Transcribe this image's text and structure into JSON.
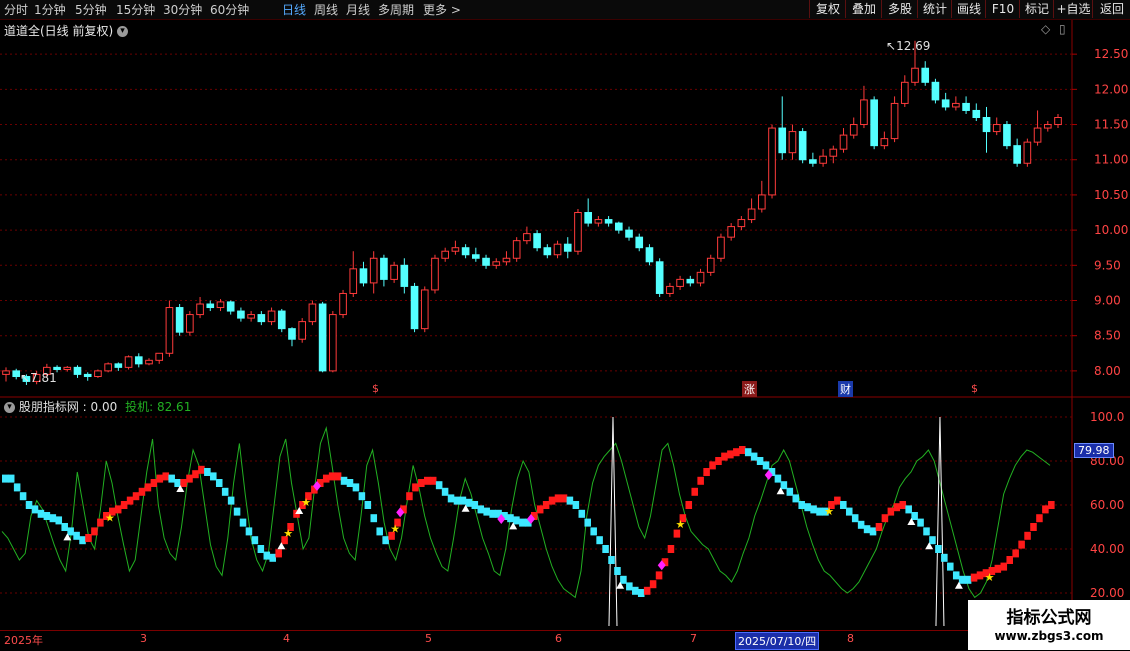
{
  "toolbar": {
    "periods": [
      {
        "label": "分时",
        "active": false
      },
      {
        "label": "1分钟",
        "active": false
      },
      {
        "label": "5分钟",
        "active": false
      },
      {
        "label": "15分钟",
        "active": false
      },
      {
        "label": "30分钟",
        "active": false
      },
      {
        "label": "60分钟",
        "active": false
      },
      {
        "label": "日线",
        "active": true
      },
      {
        "label": "周线",
        "active": false
      },
      {
        "label": "月线",
        "active": false
      },
      {
        "label": "多周期",
        "active": false
      },
      {
        "label": "更多 >",
        "active": false
      }
    ],
    "actions": [
      "复权",
      "叠加",
      "多股",
      "统计",
      "画线",
      "F10",
      "标记",
      "+自选",
      "返回"
    ]
  },
  "main_header": {
    "title": "道道全(日线 前复权)",
    "icon": "chevron-down-icon",
    "right_icon": "diamond-icon"
  },
  "price_axis": {
    "ticks": [
      "12.50",
      "12.00",
      "11.50",
      "11.00",
      "10.50",
      "10.00",
      "9.50",
      "9.00",
      "8.50",
      "8.00"
    ]
  },
  "annotations": {
    "high_label": "12.69",
    "low_label": "7.81"
  },
  "events": [
    {
      "text": "$",
      "kind": "dollar"
    },
    {
      "text": "涨",
      "kind": "limit"
    },
    {
      "text": "财",
      "kind": "finance"
    },
    {
      "text": "$",
      "kind": "dollar"
    }
  ],
  "indicator": {
    "name": "股朋指标网",
    "value_text": ": 0.00",
    "series_label": "投机",
    "series_value": "82.61",
    "axis_ticks": [
      "100.0",
      "80.00",
      "60.00",
      "40.00",
      "20.00"
    ],
    "current_badge": "79.98"
  },
  "date_axis": {
    "labels": [
      "2025年",
      "3",
      "4",
      "5",
      "6",
      "7",
      "8"
    ],
    "selected": "2025/07/10/四"
  },
  "watermark": {
    "line1": "指标公式网",
    "line2": "www.zbgs3.com"
  },
  "colors": {
    "up": "#ff3b3b",
    "down": "#54ffff",
    "grid": "#6a0000",
    "line_green": "#22b022",
    "axis_text": "#ff4444"
  },
  "chart_data": {
    "type": "candlestick",
    "price_ylim": [
      7.7,
      12.9
    ],
    "high": 12.69,
    "low": 7.81,
    "candles": [
      [
        7.95,
        8.0,
        7.85,
        8.05
      ],
      [
        8.0,
        7.92,
        7.88,
        8.03
      ],
      [
        7.92,
        7.85,
        7.8,
        7.95
      ],
      [
        7.85,
        7.95,
        7.81,
        8.0
      ],
      [
        7.95,
        8.05,
        7.9,
        8.1
      ],
      [
        8.05,
        8.02,
        7.98,
        8.08
      ],
      [
        8.02,
        8.05,
        7.99,
        8.07
      ],
      [
        8.05,
        7.95,
        7.9,
        8.08
      ],
      [
        7.95,
        7.92,
        7.86,
        7.98
      ],
      [
        7.92,
        8.0,
        7.9,
        8.02
      ],
      [
        8.0,
        8.1,
        7.98,
        8.12
      ],
      [
        8.1,
        8.05,
        8.0,
        8.12
      ],
      [
        8.05,
        8.2,
        8.02,
        8.22
      ],
      [
        8.2,
        8.1,
        8.05,
        8.25
      ],
      [
        8.1,
        8.15,
        8.08,
        8.18
      ],
      [
        8.15,
        8.25,
        8.1,
        8.25
      ],
      [
        8.25,
        8.9,
        8.2,
        9.0
      ],
      [
        8.9,
        8.55,
        8.5,
        8.95
      ],
      [
        8.55,
        8.8,
        8.5,
        8.85
      ],
      [
        8.8,
        8.95,
        8.75,
        9.05
      ],
      [
        8.95,
        8.9,
        8.85,
        9.0
      ],
      [
        8.9,
        8.98,
        8.85,
        9.02
      ],
      [
        8.98,
        8.85,
        8.8,
        9.0
      ],
      [
        8.85,
        8.75,
        8.7,
        8.9
      ],
      [
        8.75,
        8.8,
        8.7,
        8.85
      ],
      [
        8.8,
        8.7,
        8.65,
        8.85
      ],
      [
        8.7,
        8.85,
        8.65,
        8.9
      ],
      [
        8.85,
        8.6,
        8.55,
        8.88
      ],
      [
        8.6,
        8.45,
        8.35,
        8.62
      ],
      [
        8.45,
        8.7,
        8.4,
        8.75
      ],
      [
        8.7,
        8.95,
        8.65,
        9.0
      ],
      [
        8.95,
        8.0,
        7.98,
        8.98
      ],
      [
        8.0,
        8.8,
        7.98,
        8.85
      ],
      [
        8.8,
        9.1,
        8.75,
        9.15
      ],
      [
        9.1,
        9.45,
        9.05,
        9.7
      ],
      [
        9.45,
        9.25,
        9.2,
        9.55
      ],
      [
        9.25,
        9.6,
        9.1,
        9.7
      ],
      [
        9.6,
        9.3,
        9.2,
        9.65
      ],
      [
        9.3,
        9.5,
        9.25,
        9.55
      ],
      [
        9.5,
        9.2,
        9.1,
        9.6
      ],
      [
        9.2,
        8.6,
        8.55,
        9.25
      ],
      [
        8.6,
        9.15,
        8.55,
        9.2
      ],
      [
        9.15,
        9.6,
        9.1,
        9.65
      ],
      [
        9.6,
        9.7,
        9.55,
        9.75
      ],
      [
        9.7,
        9.75,
        9.65,
        9.85
      ],
      [
        9.75,
        9.65,
        9.6,
        9.8
      ],
      [
        9.65,
        9.6,
        9.55,
        9.75
      ],
      [
        9.6,
        9.5,
        9.45,
        9.65
      ],
      [
        9.5,
        9.55,
        9.45,
        9.6
      ],
      [
        9.55,
        9.6,
        9.5,
        9.7
      ],
      [
        9.6,
        9.85,
        9.55,
        9.9
      ],
      [
        9.85,
        9.95,
        9.8,
        10.05
      ],
      [
        9.95,
        9.75,
        9.7,
        10.0
      ],
      [
        9.75,
        9.65,
        9.6,
        9.8
      ],
      [
        9.65,
        9.8,
        9.6,
        9.85
      ],
      [
        9.8,
        9.7,
        9.6,
        9.9
      ],
      [
        9.7,
        10.25,
        9.65,
        10.3
      ],
      [
        10.25,
        10.1,
        10.05,
        10.45
      ],
      [
        10.1,
        10.15,
        10.05,
        10.2
      ],
      [
        10.15,
        10.1,
        10.05,
        10.2
      ],
      [
        10.1,
        10.0,
        9.95,
        10.12
      ],
      [
        10.0,
        9.9,
        9.85,
        10.05
      ],
      [
        9.9,
        9.75,
        9.7,
        9.95
      ],
      [
        9.75,
        9.55,
        9.5,
        9.8
      ],
      [
        9.55,
        9.1,
        9.05,
        9.6
      ],
      [
        9.1,
        9.2,
        9.05,
        9.25
      ],
      [
        9.2,
        9.3,
        9.15,
        9.35
      ],
      [
        9.3,
        9.25,
        9.2,
        9.35
      ],
      [
        9.25,
        9.4,
        9.2,
        9.45
      ],
      [
        9.4,
        9.6,
        9.35,
        9.65
      ],
      [
        9.6,
        9.9,
        9.55,
        9.95
      ],
      [
        9.9,
        10.05,
        9.85,
        10.1
      ],
      [
        10.05,
        10.15,
        10.0,
        10.2
      ],
      [
        10.15,
        10.3,
        10.1,
        10.45
      ],
      [
        10.3,
        10.5,
        10.25,
        10.7
      ],
      [
        10.5,
        11.45,
        10.45,
        11.5
      ],
      [
        11.45,
        11.1,
        11.0,
        11.9
      ],
      [
        11.1,
        11.4,
        11.0,
        11.5
      ],
      [
        11.4,
        11.0,
        10.95,
        11.45
      ],
      [
        11.0,
        10.95,
        10.9,
        11.1
      ],
      [
        10.95,
        11.05,
        10.9,
        11.15
      ],
      [
        11.05,
        11.15,
        10.95,
        11.2
      ],
      [
        11.15,
        11.35,
        11.1,
        11.45
      ],
      [
        11.35,
        11.5,
        11.3,
        11.6
      ],
      [
        11.5,
        11.85,
        11.45,
        12.05
      ],
      [
        11.85,
        11.2,
        11.15,
        11.9
      ],
      [
        11.2,
        11.3,
        11.15,
        11.4
      ],
      [
        11.3,
        11.8,
        11.25,
        11.9
      ],
      [
        11.8,
        12.1,
        11.75,
        12.2
      ],
      [
        12.1,
        12.3,
        12.05,
        12.69
      ],
      [
        12.3,
        12.1,
        12.05,
        12.4
      ],
      [
        12.1,
        11.85,
        11.8,
        12.15
      ],
      [
        11.85,
        11.75,
        11.7,
        11.95
      ],
      [
        11.75,
        11.8,
        11.7,
        11.9
      ],
      [
        11.8,
        11.7,
        11.65,
        11.9
      ],
      [
        11.7,
        11.6,
        11.55,
        11.8
      ],
      [
        11.6,
        11.4,
        11.1,
        11.75
      ],
      [
        11.4,
        11.5,
        11.35,
        11.6
      ],
      [
        11.5,
        11.2,
        11.15,
        11.55
      ],
      [
        11.2,
        10.95,
        10.9,
        11.3
      ],
      [
        10.95,
        11.25,
        10.9,
        11.3
      ],
      [
        11.25,
        11.45,
        11.2,
        11.7
      ],
      [
        11.45,
        11.5,
        11.4,
        11.55
      ],
      [
        11.5,
        11.6,
        11.45,
        11.65
      ]
    ],
    "indicator_ylim": [
      5,
      105
    ],
    "band": [
      72,
      72,
      68,
      64,
      60,
      58,
      56,
      55,
      54,
      53,
      50,
      48,
      46,
      44,
      45,
      48,
      52,
      55,
      57,
      58,
      60,
      62,
      64,
      66,
      68,
      70,
      72,
      73,
      72,
      70,
      70,
      72,
      74,
      76,
      75,
      73,
      70,
      66,
      62,
      57,
      52,
      48,
      44,
      40,
      37,
      36,
      38,
      44,
      50,
      56,
      60,
      64,
      67,
      70,
      72,
      73,
      73,
      71,
      70,
      68,
      64,
      60,
      54,
      48,
      44,
      46,
      52,
      58,
      64,
      68,
      70,
      71,
      71,
      69,
      66,
      63,
      62,
      62,
      61,
      60,
      58,
      57,
      56,
      56,
      55,
      54,
      53,
      52,
      52,
      55,
      58,
      60,
      62,
      63,
      63,
      62,
      60,
      56,
      52,
      48,
      44,
      40,
      35,
      30,
      26,
      23,
      21,
      20,
      21,
      24,
      28,
      34,
      40,
      47,
      54,
      60,
      66,
      71,
      75,
      78,
      80,
      82,
      83,
      84,
      85,
      84,
      82,
      80,
      78,
      75,
      72,
      69,
      66,
      63,
      60,
      59,
      58,
      57,
      57,
      60,
      62,
      60,
      57,
      54,
      51,
      49,
      48,
      50,
      54,
      57,
      59,
      60,
      58,
      55,
      52,
      48,
      44,
      40,
      36,
      32,
      28,
      26,
      26,
      27,
      28,
      29,
      30,
      31,
      32,
      35,
      38,
      42,
      46,
      50,
      54,
      58,
      60
    ],
    "band_up": [
      0,
      0,
      0,
      0,
      0,
      0,
      0,
      0,
      0,
      0,
      0,
      0,
      0,
      0,
      1,
      1,
      1,
      1,
      1,
      1,
      1,
      1,
      1,
      1,
      1,
      1,
      1,
      1,
      0,
      0,
      1,
      1,
      1,
      1,
      0,
      0,
      0,
      0,
      0,
      0,
      0,
      0,
      0,
      0,
      0,
      0,
      1,
      1,
      1,
      1,
      1,
      1,
      1,
      1,
      1,
      1,
      1,
      0,
      0,
      0,
      0,
      0,
      0,
      0,
      0,
      1,
      1,
      1,
      1,
      1,
      1,
      1,
      1,
      0,
      0,
      0,
      0,
      0,
      0,
      0,
      0,
      0,
      0,
      0,
      0,
      0,
      0,
      0,
      0,
      1,
      1,
      1,
      1,
      1,
      1,
      0,
      0,
      0,
      0,
      0,
      0,
      0,
      0,
      0,
      0,
      0,
      0,
      0,
      1,
      1,
      1,
      1,
      1,
      1,
      1,
      1,
      1,
      1,
      1,
      1,
      1,
      1,
      1,
      1,
      1,
      0,
      0,
      0,
      0,
      0,
      0,
      0,
      0,
      0,
      0,
      0,
      0,
      0,
      0,
      1,
      1,
      0,
      0,
      0,
      0,
      0,
      0,
      1,
      1,
      1,
      1,
      1,
      0,
      0,
      0,
      0,
      0,
      0,
      0,
      0,
      0,
      0,
      0,
      1,
      1,
      1,
      1,
      1,
      1,
      1,
      1,
      1,
      1,
      1,
      1,
      1,
      1,
      1,
      1
    ],
    "green": [
      48,
      45,
      40,
      35,
      38,
      55,
      62,
      58,
      50,
      42,
      35,
      30,
      48,
      75,
      60,
      45,
      40,
      58,
      80,
      70,
      55,
      42,
      30,
      35,
      55,
      75,
      90,
      60,
      45,
      38,
      35,
      50,
      70,
      85,
      78,
      60,
      42,
      32,
      28,
      45,
      70,
      88,
      65,
      45,
      35,
      30,
      38,
      60,
      82,
      90,
      70,
      55,
      40,
      45,
      68,
      88,
      95,
      78,
      60,
      45,
      38,
      35,
      55,
      78,
      85,
      70,
      52,
      40,
      35,
      45,
      62,
      78,
      68,
      55,
      45,
      38,
      32,
      30,
      45,
      62,
      72,
      65,
      55,
      45,
      38,
      30,
      28,
      40,
      58,
      72,
      80,
      75,
      60,
      50,
      40,
      32,
      26,
      22,
      20,
      18,
      30,
      55,
      70,
      78,
      82,
      85,
      88,
      80,
      70,
      60,
      50,
      45,
      55,
      70,
      85,
      88,
      78,
      65,
      55,
      48,
      45,
      42,
      40,
      35,
      30,
      28,
      25,
      30,
      38,
      45,
      55,
      62,
      70,
      78,
      80,
      85,
      80,
      70,
      60,
      50,
      42,
      35,
      30,
      28,
      25,
      22,
      20,
      22,
      25,
      30,
      35,
      40,
      48,
      55,
      60,
      68,
      72,
      75,
      80,
      82,
      85,
      80,
      70,
      60,
      50,
      40,
      30,
      22,
      18,
      20,
      25,
      35,
      50,
      65,
      72,
      78,
      82,
      85,
      84,
      82,
      80,
      78
    ],
    "spikes": [
      [
        0.583,
        100
      ],
      [
        0.895,
        100
      ]
    ]
  }
}
